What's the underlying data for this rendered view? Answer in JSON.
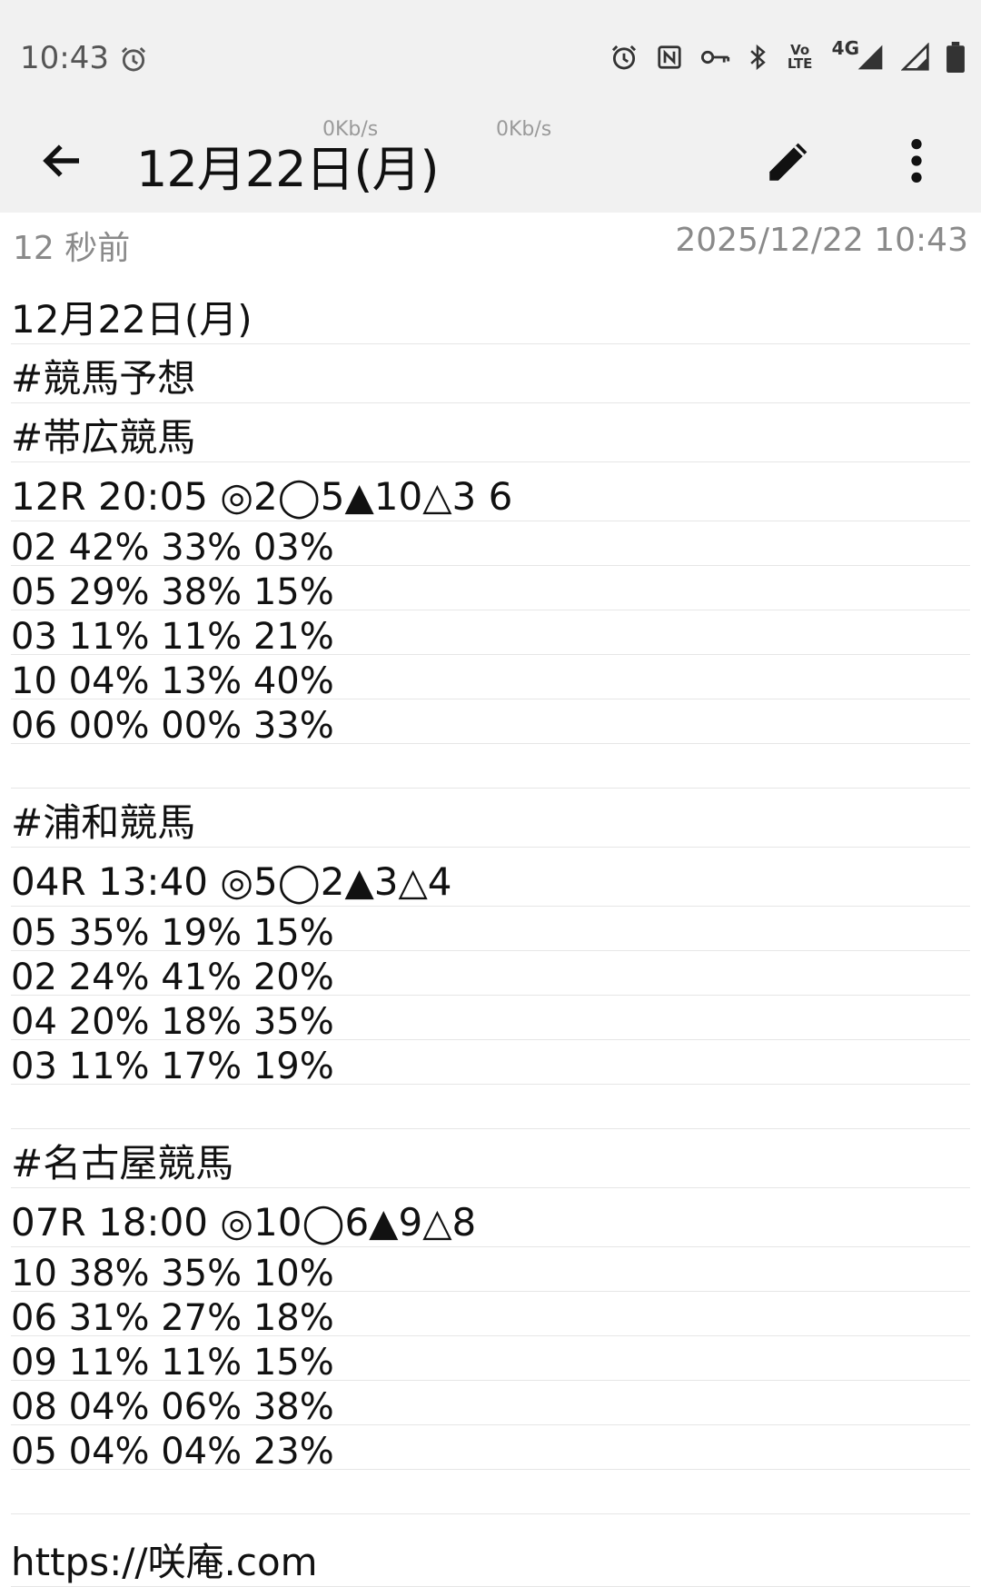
{
  "status_bar": {
    "time": "10:43",
    "network_type": "4G",
    "volte_label": "Vo LTE",
    "speeds": [
      "0Kb/s",
      "0Kb/s"
    ],
    "icons": [
      "alarm-icon",
      "nfc-icon",
      "vpn-key-icon",
      "bluetooth-icon",
      "volte-icon",
      "signal-icon",
      "signal-icon",
      "battery-icon"
    ]
  },
  "app_bar": {
    "title": "12月22日(月)",
    "back_icon": "arrow-back-icon",
    "edit_icon": "pencil-icon",
    "more_icon": "more-vert-icon"
  },
  "meta": {
    "relative_time": "12 秒前",
    "datetime": "2025/12/22 10:43"
  },
  "note": {
    "title": "12月22日(月)",
    "tag_main": "#競馬予想",
    "sections": [
      {
        "tag": "#帯広競馬",
        "race": "12R 20:05 ◎2◯5▲10△3 6",
        "rows": [
          "02 42% 33% 03%",
          "05 29% 38% 15%",
          "03 11% 11% 21%",
          "10 04% 13% 40%",
          "06 00% 00% 33%"
        ]
      },
      {
        "tag": "#浦和競馬",
        "race": "04R 13:40 ◎5◯2▲3△4",
        "rows": [
          "05 35% 19% 15%",
          "02 24% 41% 20%",
          "04 20% 18% 35%",
          "03 11% 17% 19%"
        ]
      },
      {
        "tag": "#名古屋競馬",
        "race": "07R 18:00 ◎10◯6▲9△8",
        "rows": [
          "10 38% 35% 10%",
          "06 31% 27% 18%",
          "09 11% 11% 15%",
          "08 04% 06% 38%",
          "05 04% 04% 23%"
        ]
      }
    ],
    "url": "https://咲庵.com"
  }
}
